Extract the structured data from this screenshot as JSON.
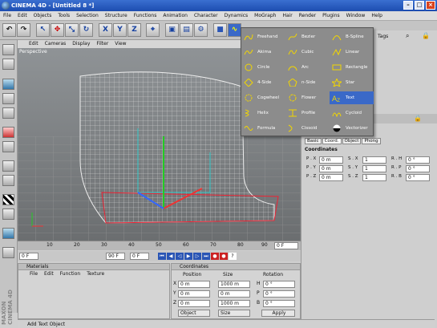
{
  "window": {
    "title": "CINEMA 4D - [Untitled 8 *]"
  },
  "menu": [
    "File",
    "Edit",
    "Objects",
    "Tools",
    "Selection",
    "Structure",
    "Functions",
    "Animation",
    "Character",
    "Dynamics",
    "MoGraph",
    "Hair",
    "Render",
    "Plugins",
    "Window",
    "Help"
  ],
  "toolbar": {
    "xyz": [
      "X",
      "Y",
      "Z"
    ]
  },
  "viewport": {
    "menu": [
      "Edit",
      "Cameras",
      "Display",
      "Filter",
      "View"
    ],
    "label": "Perspective"
  },
  "timeline": {
    "ticks": [
      "0",
      "10",
      "20",
      "30",
      "40",
      "50",
      "60",
      "70",
      "80",
      "90"
    ],
    "end_frame": "0 F"
  },
  "transport": {
    "start": "0 F",
    "end": "90 F",
    "current": "0 F"
  },
  "materials": {
    "title": "Materials",
    "menu": [
      "File",
      "Edit",
      "Function",
      "Texture"
    ]
  },
  "coordinates_panel": {
    "title": "Coordinates",
    "headers": [
      "Position",
      "Size",
      "Rotation"
    ],
    "rows": [
      {
        "axis": "X",
        "pos": "0 m",
        "size": "1000 m",
        "rot_label": "H",
        "rot": "0 °"
      },
      {
        "axis": "Y",
        "pos": "0 m",
        "size": "0 m",
        "rot_label": "P",
        "rot": "0 °"
      },
      {
        "axis": "Z",
        "pos": "0 m",
        "size": "1000 m",
        "rot_label": "B",
        "rot": "0 °"
      }
    ],
    "mode": "Object",
    "size_mode": "Size",
    "apply": "Apply"
  },
  "spline_menu": {
    "items": [
      {
        "label": "Freehand",
        "icon": "freehand-icon"
      },
      {
        "label": "Bezier",
        "icon": "bezier-icon"
      },
      {
        "label": "B-Spline",
        "icon": "bspline-icon"
      },
      {
        "label": "Akima",
        "icon": "akima-icon"
      },
      {
        "label": "Cubic",
        "icon": "cubic-icon"
      },
      {
        "label": "Linear",
        "icon": "linear-icon"
      },
      {
        "label": "Circle",
        "icon": "circle-icon"
      },
      {
        "label": "Arc",
        "icon": "arc-icon"
      },
      {
        "label": "Rectangle",
        "icon": "rectangle-icon"
      },
      {
        "label": "4-Side",
        "icon": "4-side-icon"
      },
      {
        "label": "n-Side",
        "icon": "n-side-icon"
      },
      {
        "label": "Star",
        "icon": "star-icon"
      },
      {
        "label": "Cogwheel",
        "icon": "cogwheel-icon"
      },
      {
        "label": "Flower",
        "icon": "flower-icon"
      },
      {
        "label": "Text",
        "icon": "text-icon",
        "highlighted": true
      },
      {
        "label": "Helix",
        "icon": "helix-icon"
      },
      {
        "label": "Profile",
        "icon": "profile-icon"
      },
      {
        "label": "Cycloid",
        "icon": "cycloid-icon"
      },
      {
        "label": "Formula",
        "icon": "formula-icon"
      },
      {
        "label": "Cissoid",
        "icon": "cissoid-icon"
      },
      {
        "label": "Vectorizer",
        "icon": "vectorizer-icon"
      }
    ]
  },
  "attributes": {
    "tags_label": "Tags",
    "tabs": [
      "Basic",
      "Coord.",
      "Object",
      "Phong"
    ],
    "section": "Coordinates",
    "rows": [
      {
        "a": "P . X",
        "av": "0 m",
        "b": "S . X",
        "bv": "1",
        "c": "R . H",
        "cv": "0 °"
      },
      {
        "a": "P . Y",
        "av": "0 m",
        "b": "S . Y",
        "bv": "1",
        "c": "R . P",
        "cv": "0 °"
      },
      {
        "a": "P . Z",
        "av": "0 m",
        "b": "S . Z",
        "bv": "1",
        "c": "R . B",
        "cv": "0 °"
      }
    ]
  },
  "status": "Add Text Object",
  "brand": "MAXON CINEMA 4D",
  "colors": {
    "title_bar": "#1d4db0",
    "menu_highlight": "#3a69c8",
    "spline_icon": "#f2d600"
  }
}
